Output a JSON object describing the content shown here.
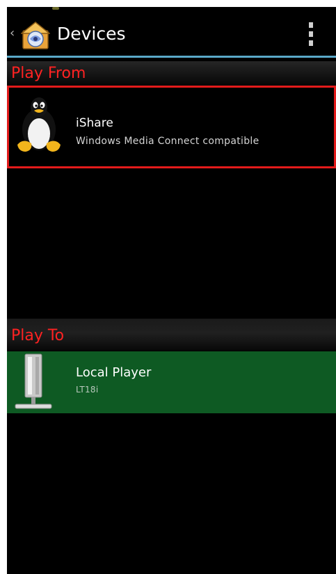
{
  "actionbar": {
    "title": "Devices",
    "back_icon": "chevron-left-icon",
    "app_icon": "media-house-icon",
    "menu_icon": "overflow-menu-icon"
  },
  "sections": {
    "play_from": {
      "header": "Play From",
      "devices": [
        {
          "name": "iShare",
          "subtitle": "Windows Media Connect compatible",
          "icon": "linux-penguin-icon",
          "selected": true
        }
      ]
    },
    "play_to": {
      "header": "Play To",
      "devices": [
        {
          "name": "Local Player",
          "subtitle": "LT18i",
          "icon": "phone-device-icon",
          "highlighted": true
        }
      ]
    }
  },
  "colors": {
    "background": "#000000",
    "accent_divider": "#5aa8c8",
    "section_header_text": "#ff2222",
    "selection_border": "#e31b1b",
    "highlight_row": "#0e5a23"
  }
}
